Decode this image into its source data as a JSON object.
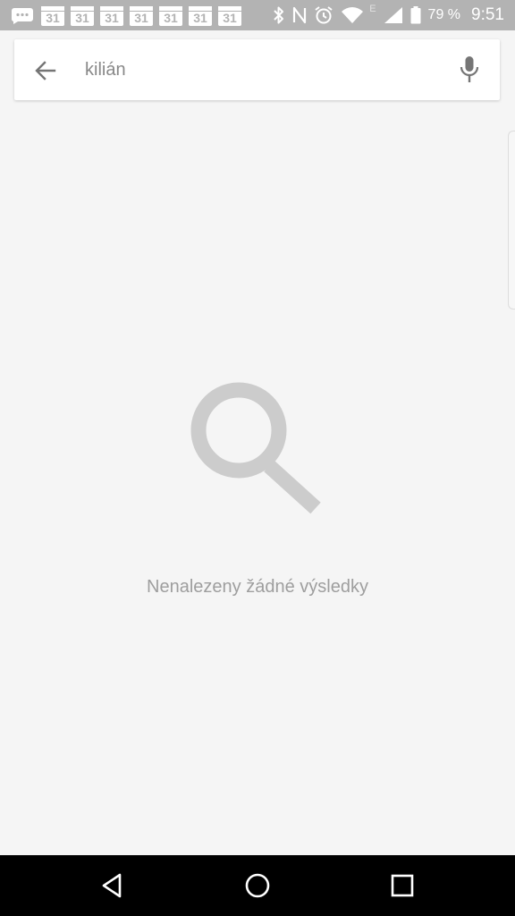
{
  "status_bar": {
    "calendar_day": "31",
    "network_letter": "E",
    "battery_percent": "79 %",
    "time": "9:51",
    "icons": [
      "chat-notification-icon",
      "calendar-icon",
      "bluetooth-icon",
      "nfc-icon",
      "alarm-icon",
      "wifi-icon",
      "cell-signal-icon",
      "battery-icon"
    ]
  },
  "search": {
    "query": "kilián",
    "back_icon": "arrow-back-icon",
    "mic_icon": "microphone-icon"
  },
  "empty_state": {
    "icon": "search-icon",
    "message": "Nenalezeny žádné výsledky"
  },
  "nav_bar": {
    "icons": [
      "nav-back-icon",
      "nav-home-icon",
      "nav-recents-icon"
    ]
  },
  "colors": {
    "status_bar_bg": "#b3b3b3",
    "page_bg": "#f5f5f5",
    "empty_icon": "#cccccc",
    "empty_text": "#9e9e9e",
    "nav_bar_bg": "#000000"
  }
}
